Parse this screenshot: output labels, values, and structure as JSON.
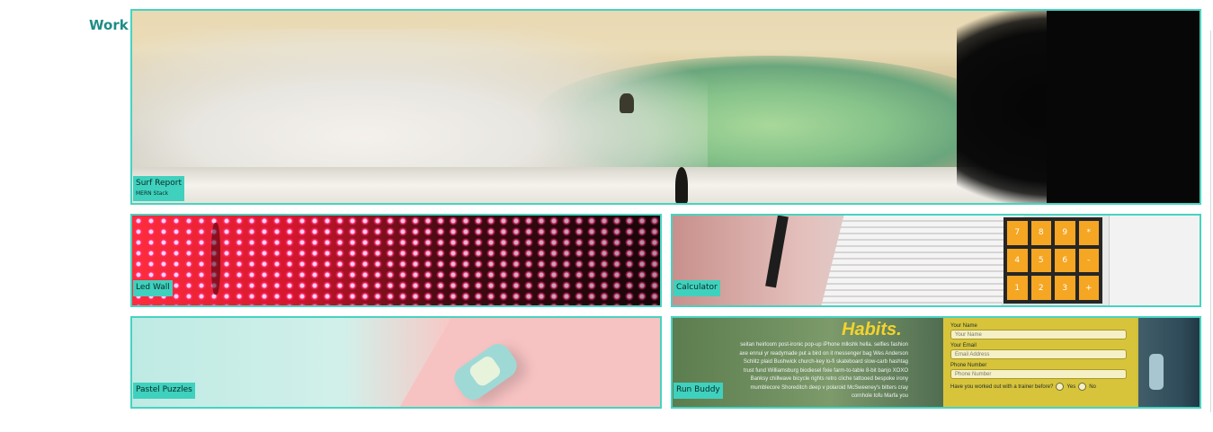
{
  "section": {
    "title": "Work"
  },
  "projects": [
    {
      "name": "Surf Report",
      "subtitle": "MERN Stack"
    },
    {
      "name": "Led Wall"
    },
    {
      "name": "Calculator"
    },
    {
      "name": "Pastel Puzzles"
    },
    {
      "name": "Run Buddy"
    }
  ],
  "calculator_keys": [
    "7",
    "8",
    "9",
    "*",
    "4",
    "5",
    "6",
    "-",
    "1",
    "2",
    "3",
    "+"
  ],
  "run_buddy": {
    "headline": "Habits.",
    "lorem": "seitan heirloom post-ironic pop-up iPhone mlkshk hella. selfies fashion axe ennui yr readymade put a bird on it messenger bag Wes Anderson Schlitz plaid Bushwick church-key lo-fi skateboard slow-carb hashtag trust fund Williamsburg biodiesel fixie farm-to-table 8-bit banjo XOXO Banksy chillwave bicycle rights retro cliche tattooed bespoke irony mumblecore Shoreditch deep v polaroid McSweeney's bitters cray cornhole tofu Marfa you",
    "form": {
      "name_label": "Your Name",
      "name_placeholder": "Your Name",
      "email_label": "Your Email",
      "email_placeholder": "Email Address",
      "phone_label": "Phone Number",
      "phone_placeholder": "Phone Number",
      "question": "Have you worked out with a trainer before?",
      "yes": "Yes",
      "no": "No"
    }
  },
  "colors": {
    "accent": "#46d3c1",
    "label_bg": "#3fd1bd",
    "title": "#1e8c87"
  }
}
